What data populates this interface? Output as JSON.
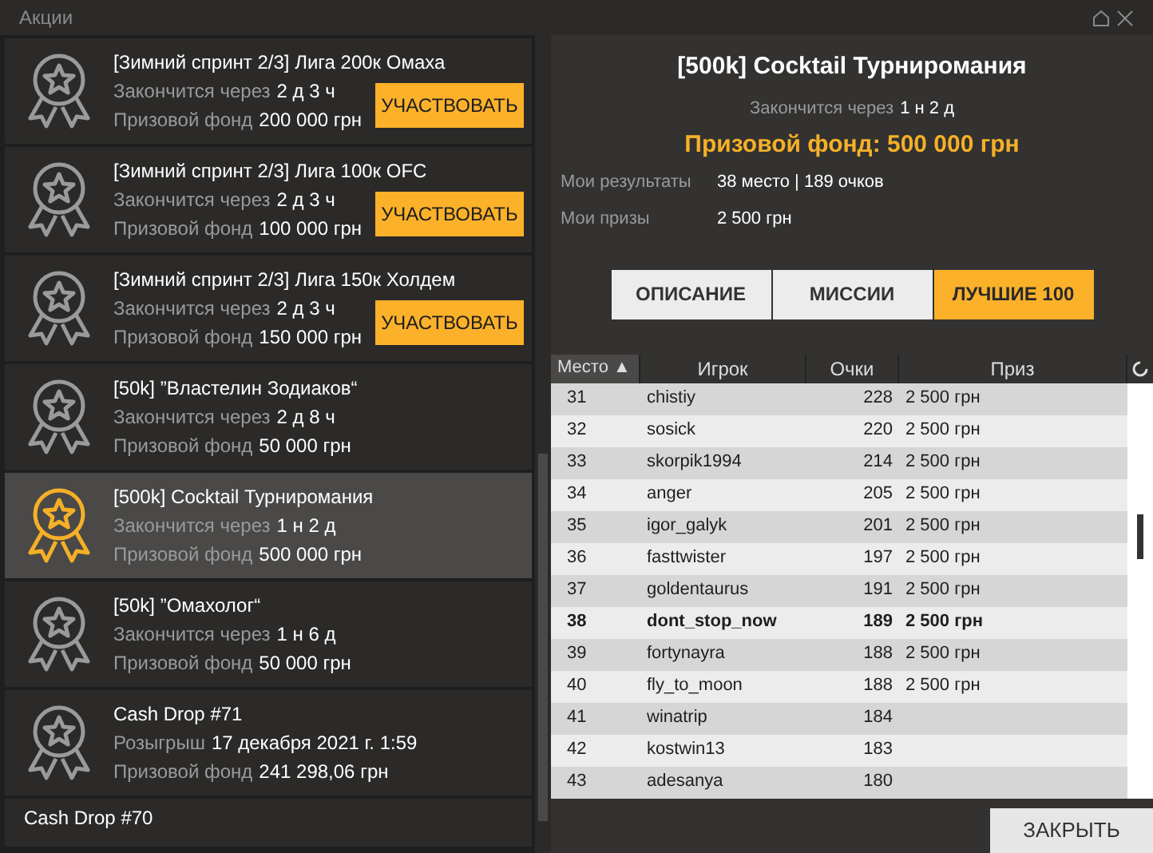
{
  "window": {
    "title": "Акции"
  },
  "promotions": [
    {
      "kind": "joinable",
      "selected": false,
      "title": "[Зимний спринт 2/3] Лига 200к Омаха",
      "lines": [
        {
          "label": "Закончится через",
          "value": "2 д 3 ч"
        },
        {
          "label": "Призовой фонд",
          "value": "200 000 грн"
        }
      ],
      "button": "УЧАСТВОВАТЬ"
    },
    {
      "kind": "joinable",
      "selected": false,
      "title": "[Зимний спринт 2/3] Лига 100к OFC",
      "lines": [
        {
          "label": "Закончится через",
          "value": "2 д 3 ч"
        },
        {
          "label": "Призовой фонд",
          "value": "100 000 грн"
        }
      ],
      "button": "УЧАСТВОВАТЬ"
    },
    {
      "kind": "joinable",
      "selected": false,
      "title": "[Зимний спринт 2/3] Лига 150к Холдем",
      "lines": [
        {
          "label": "Закончится через",
          "value": "2 д 3 ч"
        },
        {
          "label": "Призовой фонд",
          "value": "150 000 грн"
        }
      ],
      "button": "УЧАСТВОВАТЬ"
    },
    {
      "kind": "plain",
      "selected": false,
      "title": "[50k] ”Властелин Зодиаков“",
      "lines": [
        {
          "label": "Закончится через",
          "value": "2 д 8 ч"
        },
        {
          "label": "Призовой фонд",
          "value": "50 000 грн"
        }
      ]
    },
    {
      "kind": "plain",
      "selected": true,
      "title": "[500k] Cocktail Турниромания",
      "lines": [
        {
          "label": "Закончится через",
          "value": "1 н 2 д"
        },
        {
          "label": "Призовой фонд",
          "value": "500 000 грн"
        }
      ]
    },
    {
      "kind": "plain",
      "selected": false,
      "title": "[50k] ”Омахолог“",
      "lines": [
        {
          "label": "Закончится через",
          "value": "1 н 6 д"
        },
        {
          "label": "Призовой фонд",
          "value": "50 000 грн"
        }
      ]
    },
    {
      "kind": "plain",
      "selected": false,
      "title": "Cash Drop #71",
      "lines": [
        {
          "label": "Розыгрыш",
          "value": "17 декабря 2021 г. 1:59"
        },
        {
          "label": "Призовой фонд",
          "value": "241 298,06 грн"
        }
      ]
    },
    {
      "kind": "plain",
      "selected": false,
      "title": "Cash Drop #70"
    }
  ],
  "detail": {
    "title": "[500k] Cocktail Турниромания",
    "ends": {
      "label": "Закончится через",
      "value": "1 н 2 д"
    },
    "prize_pool": "Призовой фонд: 500 000 грн",
    "stats": [
      {
        "label": "Мои результаты",
        "value": "38 место | 189 очков"
      },
      {
        "label": "Мои призы",
        "value": "2 500 грн"
      }
    ],
    "tabs": [
      {
        "label": "ОПИСАНИЕ",
        "selected": false
      },
      {
        "label": "МИССИИ",
        "selected": false
      },
      {
        "label": "ЛУЧШИЕ 100",
        "selected": true
      }
    ]
  },
  "table": {
    "columns": [
      "Место ▲",
      "Игрок",
      "Очки",
      "Приз"
    ],
    "rows": [
      {
        "place": "31",
        "player": "chistiy",
        "points": "228",
        "prize": "2 500 грн",
        "current_user": false
      },
      {
        "place": "32",
        "player": "sosick",
        "points": "220",
        "prize": "2 500 грн",
        "current_user": false
      },
      {
        "place": "33",
        "player": "skorpik1994",
        "points": "214",
        "prize": "2 500 грн",
        "current_user": false
      },
      {
        "place": "34",
        "player": "anger",
        "points": "205",
        "prize": "2 500 грн",
        "current_user": false
      },
      {
        "place": "35",
        "player": "igor_galyk",
        "points": "201",
        "prize": "2 500 грн",
        "current_user": false
      },
      {
        "place": "36",
        "player": "fasttwister",
        "points": "197",
        "prize": "2 500 грн",
        "current_user": false
      },
      {
        "place": "37",
        "player": "goldentaurus",
        "points": "191",
        "prize": "2 500 грн",
        "current_user": false
      },
      {
        "place": "38",
        "player": "dont_stop_now",
        "points": "189",
        "prize": "2 500 грн",
        "current_user": true
      },
      {
        "place": "39",
        "player": "fortynayra",
        "points": "188",
        "prize": "2 500 грн",
        "current_user": false
      },
      {
        "place": "40",
        "player": "fly_to_moon",
        "points": "188",
        "prize": "2 500 грн",
        "current_user": false
      },
      {
        "place": "41",
        "player": "winatrip",
        "points": "184",
        "current_user": false
      },
      {
        "place": "42",
        "player": "kostwin13",
        "points": "183",
        "current_user": false
      },
      {
        "place": "43",
        "player": "adesanya",
        "points": "180",
        "current_user": false
      }
    ]
  },
  "close_button": "ЗАКРЫТЬ"
}
